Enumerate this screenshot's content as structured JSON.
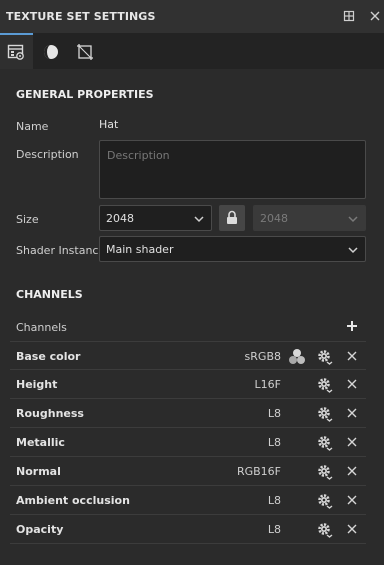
{
  "window": {
    "title": "TEXTURE SET SETTINGS"
  },
  "general": {
    "section_title": "GENERAL PROPERTIES",
    "name_label": "Name",
    "name_value": "Hat",
    "description_label": "Description",
    "description_placeholder": "Description",
    "size_label": "Size",
    "size_value": "2048",
    "size_linked_value": "2048",
    "shader_label": "Shader Instance",
    "shader_value": "Main shader"
  },
  "channels": {
    "section_title": "CHANNELS",
    "list_label": "Channels",
    "items": [
      {
        "name": "Base color",
        "format": "sRGB8"
      },
      {
        "name": "Height",
        "format": "L16F"
      },
      {
        "name": "Roughness",
        "format": "L8"
      },
      {
        "name": "Metallic",
        "format": "L8"
      },
      {
        "name": "Normal",
        "format": "RGB16F"
      },
      {
        "name": "Ambient occlusion",
        "format": "L8"
      },
      {
        "name": "Opacity",
        "format": "L8"
      }
    ]
  },
  "icons": {
    "maximize": "maximize-icon",
    "close": "close-icon",
    "tab1": "texture-set-settings-icon",
    "tab2": "shader-sphere-icon",
    "tab3": "uv-frame-icon",
    "lock": "lock-icon",
    "add": "plus-icon",
    "srgb": "color-circles-icon",
    "gear": "gear-icon",
    "remove": "close-icon"
  },
  "colors": {
    "accent": "#5b9bd5",
    "panel": "#2b2b2b",
    "field": "#1f1f1f"
  }
}
